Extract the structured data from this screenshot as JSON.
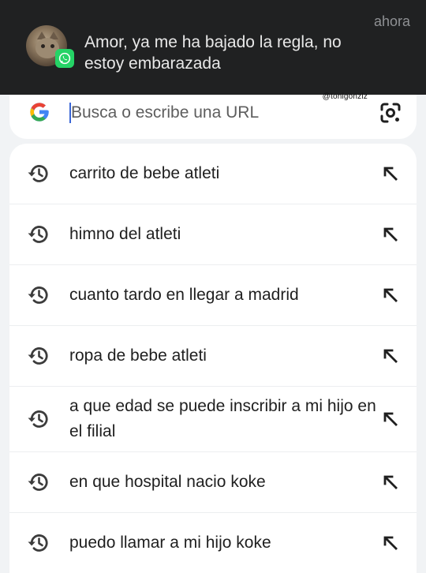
{
  "notification": {
    "time": "ahora",
    "message": "Amor, ya me ha bajado la regla, no estoy embarazada",
    "app_icon": "whatsapp-icon",
    "avatar": "cat-photo"
  },
  "watermark": "@tonigonzlz",
  "search": {
    "placeholder": "Busca o escribe una URL",
    "left_icon": "google-logo",
    "right_icon": "google-lens-icon"
  },
  "suggestions": [
    {
      "text": "carrito de bebe atleti",
      "icon": "history-icon",
      "action_icon": "arrow-up-left-icon"
    },
    {
      "text": "himno del atleti",
      "icon": "history-icon",
      "action_icon": "arrow-up-left-icon"
    },
    {
      "text": "cuanto tardo en llegar a madrid",
      "icon": "history-icon",
      "action_icon": "arrow-up-left-icon"
    },
    {
      "text": "ropa de bebe atleti",
      "icon": "history-icon",
      "action_icon": "arrow-up-left-icon"
    },
    {
      "text": "a que edad se puede inscribir a mi hijo en el filial",
      "icon": "history-icon",
      "action_icon": "arrow-up-left-icon"
    },
    {
      "text": "en que hospital nacio koke",
      "icon": "history-icon",
      "action_icon": "arrow-up-left-icon"
    },
    {
      "text": "puedo llamar a mi hijo koke",
      "icon": "history-icon",
      "action_icon": "arrow-up-left-icon"
    }
  ],
  "colors": {
    "notification_bg": "#202122",
    "page_bg": "#f1f3f5",
    "whatsapp_green": "#25d366",
    "caret_blue": "#3a66d6"
  }
}
